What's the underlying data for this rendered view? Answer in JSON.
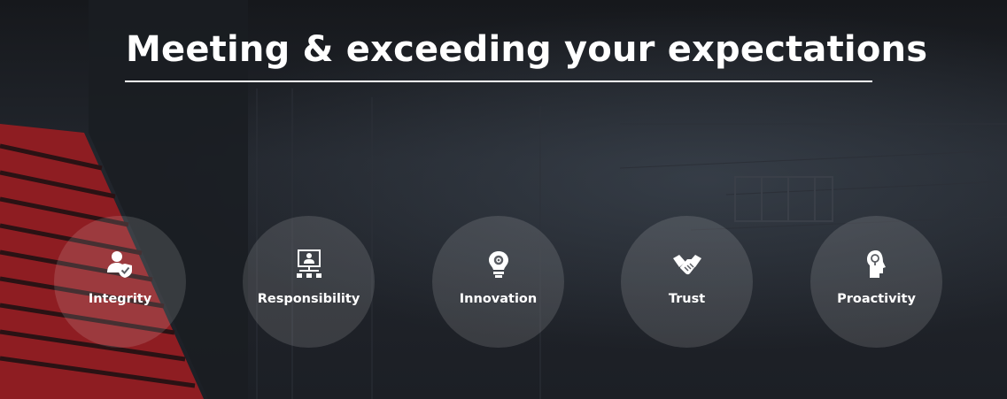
{
  "heading": "Meeting & exceeding your expectations",
  "values": [
    {
      "label": "Integrity",
      "icon": "user-shield-icon"
    },
    {
      "label": "Responsibility",
      "icon": "presentation-org-icon"
    },
    {
      "label": "Innovation",
      "icon": "lightbulb-gear-icon"
    },
    {
      "label": "Trust",
      "icon": "handshake-icon"
    },
    {
      "label": "Proactivity",
      "icon": "head-lightbulb-icon"
    }
  ],
  "colors": {
    "accent": "#c8282d",
    "background": "#1b1e24",
    "text": "#ffffff"
  }
}
